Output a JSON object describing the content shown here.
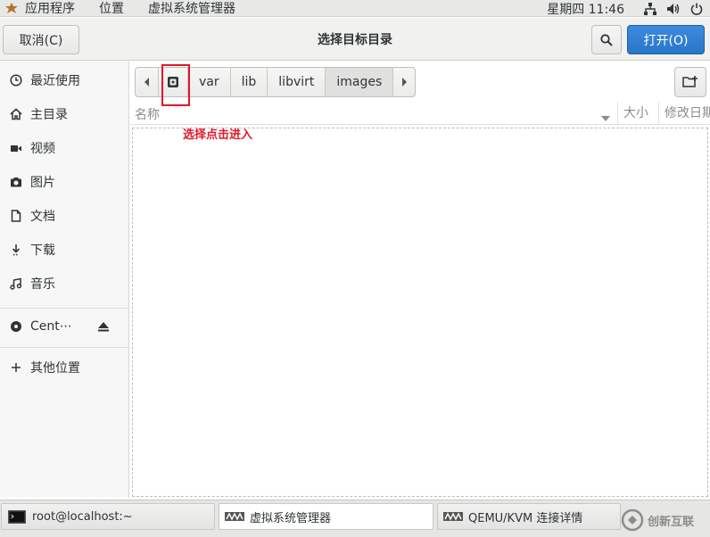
{
  "topbar": {
    "menus": [
      "应用程序",
      "位置",
      "虚拟系统管理器"
    ],
    "clock": "星期四 11:46",
    "icons": [
      "network-icon",
      "volume-icon",
      "power-icon"
    ]
  },
  "header": {
    "cancel_label": "取消(C)",
    "title": "选择目标目录",
    "open_label": "打开(O)"
  },
  "sidebar": {
    "items": [
      {
        "label": "最近使用",
        "icon": "clock-icon"
      },
      {
        "label": "主目录",
        "icon": "home-icon"
      },
      {
        "label": "视频",
        "icon": "video-icon"
      },
      {
        "label": "图片",
        "icon": "camera-icon"
      },
      {
        "label": "文档",
        "icon": "document-icon"
      },
      {
        "label": "下载",
        "icon": "download-icon"
      },
      {
        "label": "音乐",
        "icon": "music-icon"
      }
    ],
    "device": {
      "label": "Cent⋯",
      "icon": "disc-icon"
    },
    "other": {
      "label": "其他位置",
      "icon": "plus-icon"
    }
  },
  "pathbar": {
    "segments": [
      "var",
      "lib",
      "libvirt",
      "images"
    ]
  },
  "columns": {
    "name": "名称",
    "size": "大小",
    "modified": "修改日期"
  },
  "annotation": {
    "text": "选择点击进入",
    "color": "#e0182a"
  },
  "taskbar": {
    "tasks": [
      "root@localhost:~",
      "虚拟系统管理器",
      "QEMU/KVM 连接详情"
    ],
    "watermark": "创新互联"
  },
  "colors": {
    "accent": "#2a76c6",
    "annotation": "#e0182a"
  }
}
